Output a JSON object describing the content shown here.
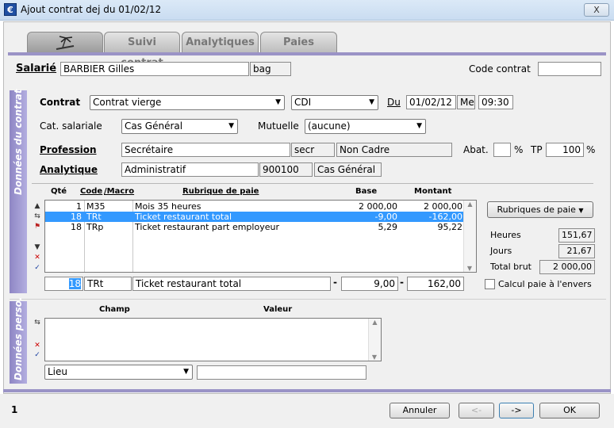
{
  "window": {
    "title": "Ajout contrat dej du 01/02/12",
    "close_label": "X"
  },
  "tabs": [
    {
      "label": ""
    },
    {
      "label": "Suivi contrat"
    },
    {
      "label": "Analytiques"
    },
    {
      "label": "Paies"
    }
  ],
  "salarie": {
    "label": "Salarié",
    "name": "BARBIER Gilles",
    "code": "bag",
    "code_contrat_label": "Code contrat",
    "code_contrat": ""
  },
  "contrat_section": {
    "side_label": "Données du contrat",
    "contrat_label": "Contrat",
    "contrat_value": "Contrat vierge",
    "type_value": "CDI",
    "du_label": "Du",
    "date": "01/02/12",
    "day": "Me",
    "time": "09:30",
    "cat_label": "Cat. salariale",
    "cat_value": "Cas Général",
    "mutuelle_label": "Mutuelle",
    "mutuelle_value": "(aucune)",
    "profession_label": "Profession",
    "profession_value": "Secrétaire",
    "profession_code": "secr",
    "profession_statut": "Non Cadre",
    "abat_label": "Abat.",
    "abat_value": "",
    "pct": "%",
    "tp_label": "TP",
    "tp_value": "100",
    "analytique_label": "Analytique",
    "analytique_value": "Administratif",
    "analytique_code": "900100",
    "analytique_cat": "Cas Général"
  },
  "rubriques": {
    "headers": {
      "qte": "Qté",
      "code": "Code",
      "macro": "/Macro",
      "rubrique": "Rubrique de paie",
      "base": "Base",
      "montant": "Montant"
    },
    "rows": [
      {
        "qte": "1",
        "code": "M35",
        "libelle": "Mois 35 heures",
        "base": "2 000,00",
        "montant": "2 000,00"
      },
      {
        "qte": "18",
        "code": "TRt",
        "libelle": "Ticket restaurant total",
        "base": "-9,00",
        "montant": "-162,00"
      },
      {
        "qte": "18",
        "code": "TRp",
        "libelle": "Ticket restaurant part employeur",
        "base": "5,29",
        "montant": "95,22"
      }
    ],
    "edit": {
      "qte": "18",
      "code": "TRt",
      "libelle": "Ticket restaurant total",
      "sign1": "-",
      "base": "9,00",
      "sign2": "-",
      "montant": "162,00"
    },
    "button": "Rubriques de paie",
    "heures_label": "Heures",
    "heures": "151,67",
    "jours_label": "Jours",
    "jours": "21,67",
    "total_label": "Total brut",
    "total": "2 000,00",
    "envers_label": "Calcul paie à l'envers"
  },
  "perso_section": {
    "side_label": "Données perso.",
    "champ_header": "Champ",
    "valeur_header": "Valeur",
    "lieu_value": "Lieu",
    "lieu_input": ""
  },
  "footer": {
    "page": "1",
    "annuler": "Annuler",
    "prev": "<-",
    "next": "->",
    "ok": "OK"
  }
}
